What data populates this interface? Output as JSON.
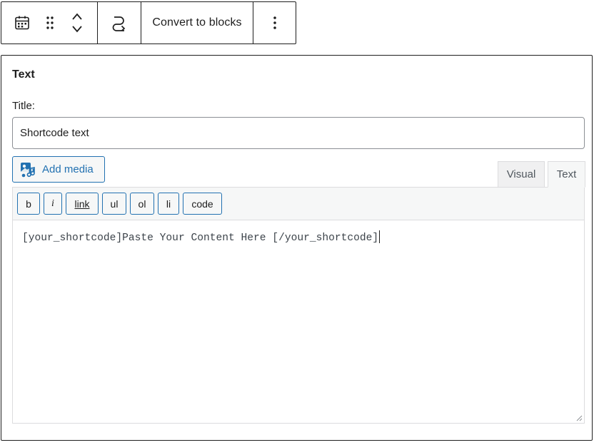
{
  "toolbar": {
    "block_icon": "calendar-icon",
    "drag_icon": "drag-handle-icon",
    "move_icon": "chevron-up-down-icon",
    "transform_icon": "transform-icon",
    "convert_label": "Convert to blocks",
    "more_icon": "more-vertical-icon"
  },
  "widget": {
    "title": "Text",
    "title_field_label": "Title:",
    "title_field_value": "Shortcode text",
    "add_media_label": "Add media",
    "tabs": [
      {
        "label": "Visual",
        "active": false
      },
      {
        "label": "Text",
        "active": true
      }
    ],
    "quicktags": [
      "b",
      "i",
      "link",
      "ul",
      "ol",
      "li",
      "code"
    ],
    "content": "[your_shortcode]Paste Your Content Here [/your_shortcode]"
  },
  "colors": {
    "accent": "#2271b1",
    "border_dark": "#1e1e1e",
    "toolbar_bg": "#f6f7f7"
  }
}
